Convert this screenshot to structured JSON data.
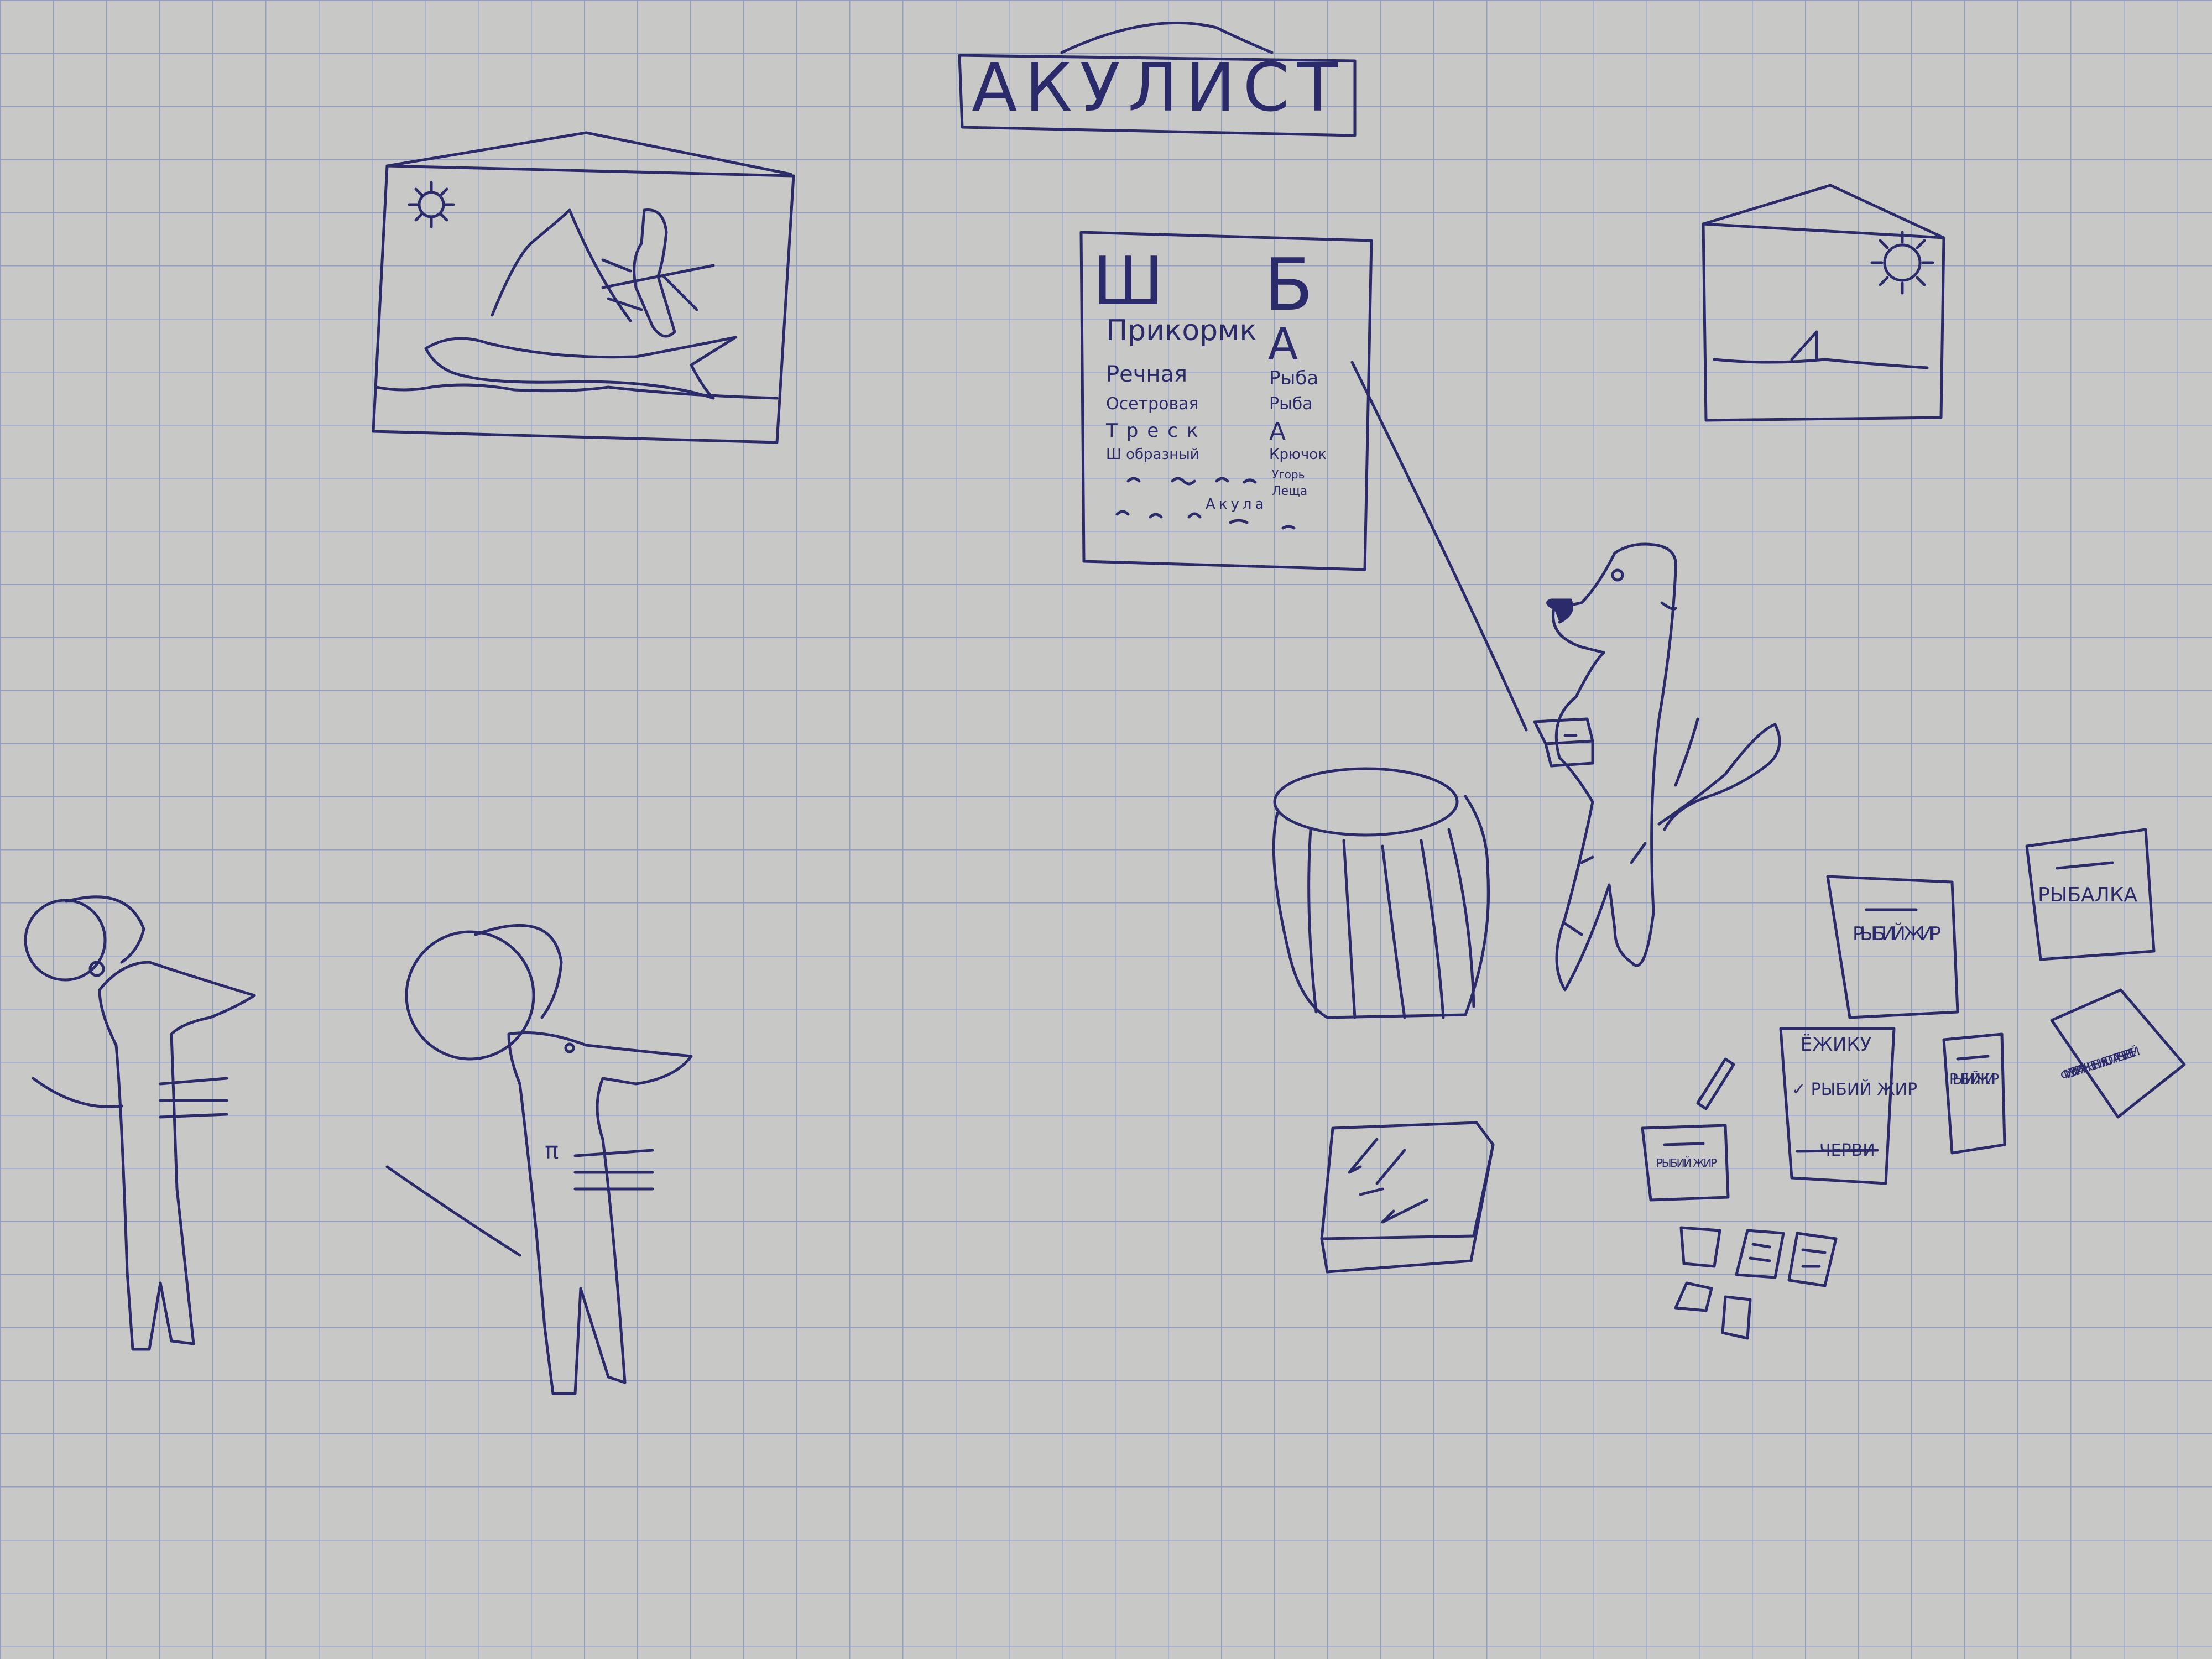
{
  "ink_color": "#2b2a6b",
  "paper_color": "#c9c9c7",
  "grid_color": "#7f8fc0",
  "sign": {
    "title": "АКУЛИСТ"
  },
  "chart": {
    "big_letters": [
      "Ш",
      "Б",
      "А"
    ],
    "rows": [
      [
        "Прикормк",
        ""
      ],
      [
        "Речная",
        "Рыба"
      ],
      [
        "Осетровая",
        "Рыба"
      ],
      [
        "Треск",
        "А"
      ],
      [
        "Ш образный",
        "Крючок"
      ],
      [
        "",
        "Угорь"
      ],
      [
        "",
        "Леща"
      ],
      [
        "",
        "Акула"
      ]
    ]
  },
  "notes": {
    "fish_oil_1": "РЫБИЙ ЖИР",
    "fishing": "РЫБАЛКА",
    "hedgehog_title": "ЁЖИКУ",
    "hedgehog_item": "✓ РЫБИЙ ЖИР",
    "hedgehog_crossed": "ЧЕРВИ",
    "fish_oil_2": "РЫБИЙ ЖИР",
    "exercise": "ФИЗ. УПРАЖНЕНИЯ: КОПАТЬ ЧЕРВЕЙ",
    "fish_oil_small": "РЫБИЙ ЖИР"
  },
  "icons": [
    "sun-icon",
    "shark-fin-icon",
    "pencil-icon",
    "fish-icon"
  ]
}
